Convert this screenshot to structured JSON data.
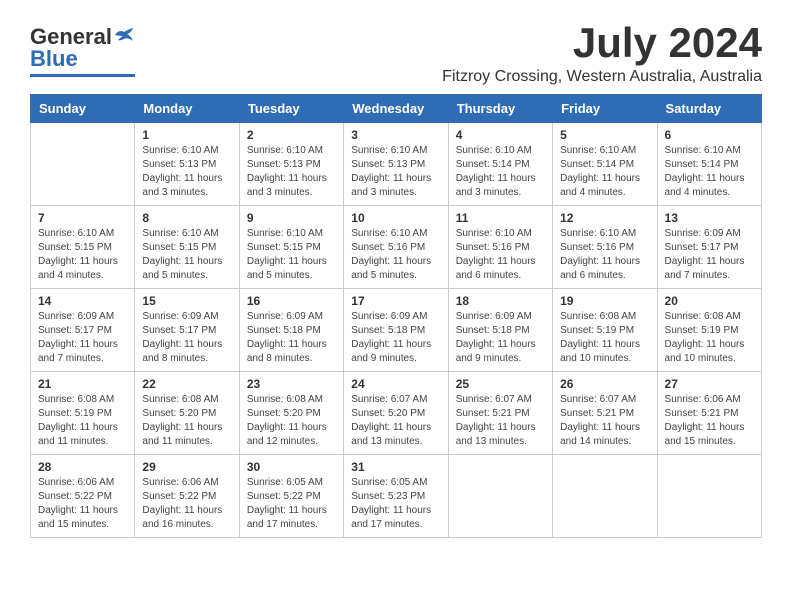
{
  "header": {
    "logo_general": "General",
    "logo_blue": "Blue",
    "month": "July 2024",
    "location": "Fitzroy Crossing, Western Australia, Australia"
  },
  "days_of_week": [
    "Sunday",
    "Monday",
    "Tuesday",
    "Wednesday",
    "Thursday",
    "Friday",
    "Saturday"
  ],
  "weeks": [
    [
      {
        "day": "",
        "info": ""
      },
      {
        "day": "1",
        "info": "Sunrise: 6:10 AM\nSunset: 5:13 PM\nDaylight: 11 hours\nand 3 minutes."
      },
      {
        "day": "2",
        "info": "Sunrise: 6:10 AM\nSunset: 5:13 PM\nDaylight: 11 hours\nand 3 minutes."
      },
      {
        "day": "3",
        "info": "Sunrise: 6:10 AM\nSunset: 5:13 PM\nDaylight: 11 hours\nand 3 minutes."
      },
      {
        "day": "4",
        "info": "Sunrise: 6:10 AM\nSunset: 5:14 PM\nDaylight: 11 hours\nand 3 minutes."
      },
      {
        "day": "5",
        "info": "Sunrise: 6:10 AM\nSunset: 5:14 PM\nDaylight: 11 hours\nand 4 minutes."
      },
      {
        "day": "6",
        "info": "Sunrise: 6:10 AM\nSunset: 5:14 PM\nDaylight: 11 hours\nand 4 minutes."
      }
    ],
    [
      {
        "day": "7",
        "info": "Sunrise: 6:10 AM\nSunset: 5:15 PM\nDaylight: 11 hours\nand 4 minutes."
      },
      {
        "day": "8",
        "info": "Sunrise: 6:10 AM\nSunset: 5:15 PM\nDaylight: 11 hours\nand 5 minutes."
      },
      {
        "day": "9",
        "info": "Sunrise: 6:10 AM\nSunset: 5:15 PM\nDaylight: 11 hours\nand 5 minutes."
      },
      {
        "day": "10",
        "info": "Sunrise: 6:10 AM\nSunset: 5:16 PM\nDaylight: 11 hours\nand 5 minutes."
      },
      {
        "day": "11",
        "info": "Sunrise: 6:10 AM\nSunset: 5:16 PM\nDaylight: 11 hours\nand 6 minutes."
      },
      {
        "day": "12",
        "info": "Sunrise: 6:10 AM\nSunset: 5:16 PM\nDaylight: 11 hours\nand 6 minutes."
      },
      {
        "day": "13",
        "info": "Sunrise: 6:09 AM\nSunset: 5:17 PM\nDaylight: 11 hours\nand 7 minutes."
      }
    ],
    [
      {
        "day": "14",
        "info": "Sunrise: 6:09 AM\nSunset: 5:17 PM\nDaylight: 11 hours\nand 7 minutes."
      },
      {
        "day": "15",
        "info": "Sunrise: 6:09 AM\nSunset: 5:17 PM\nDaylight: 11 hours\nand 8 minutes."
      },
      {
        "day": "16",
        "info": "Sunrise: 6:09 AM\nSunset: 5:18 PM\nDaylight: 11 hours\nand 8 minutes."
      },
      {
        "day": "17",
        "info": "Sunrise: 6:09 AM\nSunset: 5:18 PM\nDaylight: 11 hours\nand 9 minutes."
      },
      {
        "day": "18",
        "info": "Sunrise: 6:09 AM\nSunset: 5:18 PM\nDaylight: 11 hours\nand 9 minutes."
      },
      {
        "day": "19",
        "info": "Sunrise: 6:08 AM\nSunset: 5:19 PM\nDaylight: 11 hours\nand 10 minutes."
      },
      {
        "day": "20",
        "info": "Sunrise: 6:08 AM\nSunset: 5:19 PM\nDaylight: 11 hours\nand 10 minutes."
      }
    ],
    [
      {
        "day": "21",
        "info": "Sunrise: 6:08 AM\nSunset: 5:19 PM\nDaylight: 11 hours\nand 11 minutes."
      },
      {
        "day": "22",
        "info": "Sunrise: 6:08 AM\nSunset: 5:20 PM\nDaylight: 11 hours\nand 11 minutes."
      },
      {
        "day": "23",
        "info": "Sunrise: 6:08 AM\nSunset: 5:20 PM\nDaylight: 11 hours\nand 12 minutes."
      },
      {
        "day": "24",
        "info": "Sunrise: 6:07 AM\nSunset: 5:20 PM\nDaylight: 11 hours\nand 13 minutes."
      },
      {
        "day": "25",
        "info": "Sunrise: 6:07 AM\nSunset: 5:21 PM\nDaylight: 11 hours\nand 13 minutes."
      },
      {
        "day": "26",
        "info": "Sunrise: 6:07 AM\nSunset: 5:21 PM\nDaylight: 11 hours\nand 14 minutes."
      },
      {
        "day": "27",
        "info": "Sunrise: 6:06 AM\nSunset: 5:21 PM\nDaylight: 11 hours\nand 15 minutes."
      }
    ],
    [
      {
        "day": "28",
        "info": "Sunrise: 6:06 AM\nSunset: 5:22 PM\nDaylight: 11 hours\nand 15 minutes."
      },
      {
        "day": "29",
        "info": "Sunrise: 6:06 AM\nSunset: 5:22 PM\nDaylight: 11 hours\nand 16 minutes."
      },
      {
        "day": "30",
        "info": "Sunrise: 6:05 AM\nSunset: 5:22 PM\nDaylight: 11 hours\nand 17 minutes."
      },
      {
        "day": "31",
        "info": "Sunrise: 6:05 AM\nSunset: 5:23 PM\nDaylight: 11 hours\nand 17 minutes."
      },
      {
        "day": "",
        "info": ""
      },
      {
        "day": "",
        "info": ""
      },
      {
        "day": "",
        "info": ""
      }
    ]
  ]
}
